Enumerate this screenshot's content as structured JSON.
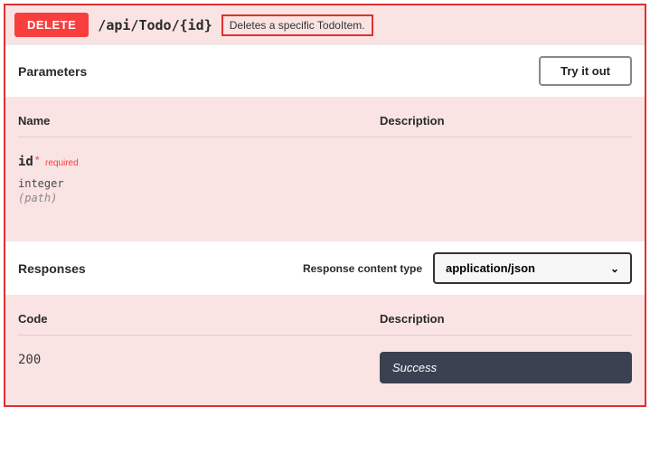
{
  "operation": {
    "method": "DELETE",
    "path": "/api/Todo/{id}",
    "summary": "Deletes a specific TodoItem."
  },
  "parameters_section": {
    "title": "Parameters",
    "try_button": "Try it out",
    "headers": {
      "name": "Name",
      "description": "Description"
    },
    "items": [
      {
        "name": "id",
        "required_label": "required",
        "type": "integer",
        "in": "(path)"
      }
    ]
  },
  "responses_section": {
    "title": "Responses",
    "content_type_label": "Response content type",
    "content_type_value": "application/json",
    "headers": {
      "code": "Code",
      "description": "Description"
    },
    "items": [
      {
        "code": "200",
        "description": "Success"
      }
    ]
  }
}
